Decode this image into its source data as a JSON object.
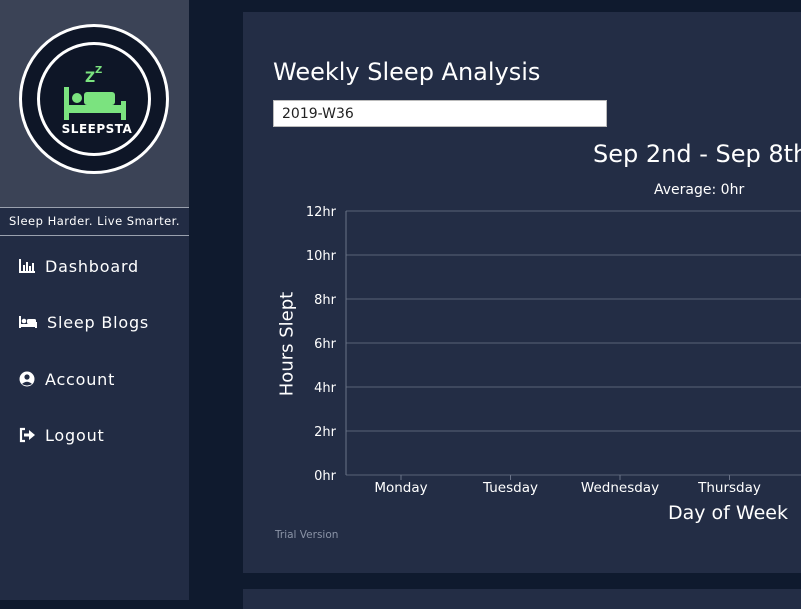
{
  "sidebar": {
    "logo_text": "SLEEPSTA",
    "tagline": "Sleep Harder. Live Smarter.",
    "items": [
      {
        "label": "Dashboard",
        "icon": "bar-chart-icon"
      },
      {
        "label": "Sleep Blogs",
        "icon": "bed-icon"
      },
      {
        "label": "Account",
        "icon": "user-circle-icon"
      },
      {
        "label": "Logout",
        "icon": "sign-out-icon"
      }
    ]
  },
  "main": {
    "title": "Weekly Sleep Analysis",
    "week_value": "2019-W36",
    "range_title": "Sep 2nd - Sep 8th",
    "average": "Average: 0hr",
    "trial": "Trial Version"
  },
  "colors": {
    "accent_green": "#7be37f",
    "sidebar_bg": "#222c44",
    "card_bg": "#232d45"
  },
  "chart_data": {
    "type": "bar",
    "title": "Sep 2nd - Sep 8th",
    "subtitle": "Average: 0hr",
    "xlabel": "Day of Week",
    "ylabel": "Hours Slept",
    "categories": [
      "Monday",
      "Tuesday",
      "Wednesday",
      "Thursday"
    ],
    "values": [
      0,
      0,
      0,
      0
    ],
    "ylim": [
      0,
      12
    ],
    "yticks": [
      0,
      2,
      4,
      6,
      8,
      10,
      12
    ],
    "ytick_suffix": "hr",
    "grid": true
  }
}
